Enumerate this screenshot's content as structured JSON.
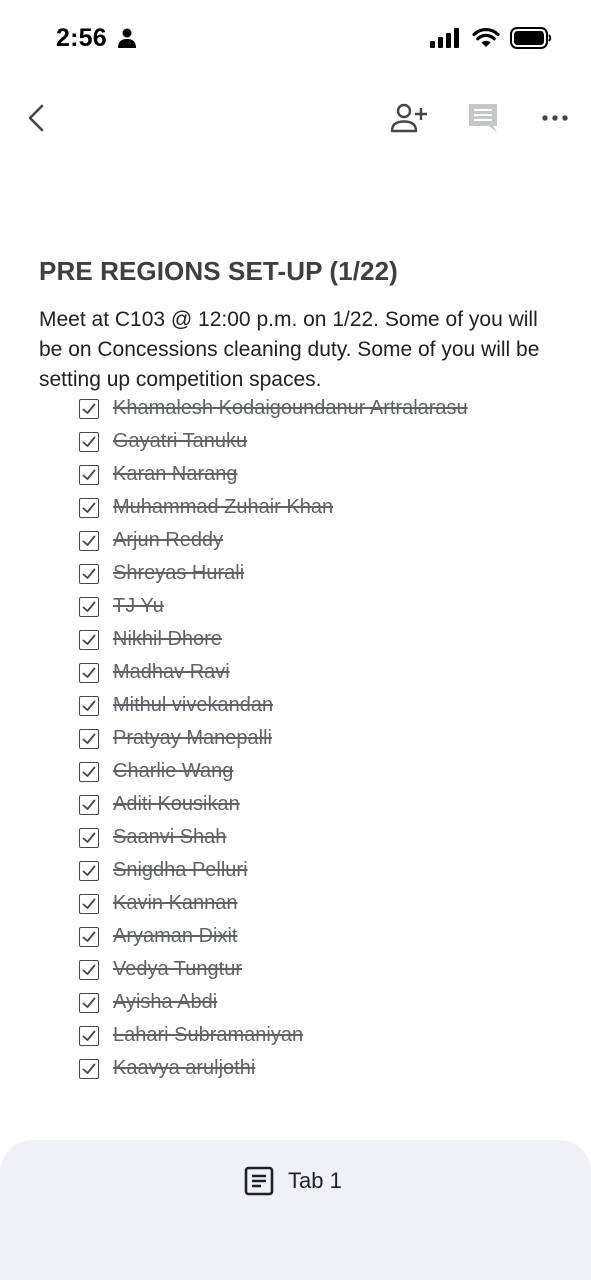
{
  "status_bar": {
    "time": "2:56"
  },
  "toolbar": {
    "back_icon": "chevron-left-icon",
    "share_icon": "person-add-icon",
    "comment_icon": "comment-icon",
    "more_icon": "more-horizontal-icon"
  },
  "document": {
    "title": "PRE REGIONS SET-UP (1/22)",
    "body": "Meet at C103 @ 12:00 p.m. on 1/22. Some of you will be on Concessions cleaning duty. Some of you will be setting up competition spaces."
  },
  "checklist": [
    {
      "label": "Khamalesh Kodaigoundanur Artralarasu",
      "checked": true
    },
    {
      "label": "Gayatri Tanuku",
      "checked": true
    },
    {
      "label": "Karan Narang",
      "checked": true
    },
    {
      "label": "Muhammad Zuhair Khan",
      "checked": true
    },
    {
      "label": "Arjun Reddy",
      "checked": true
    },
    {
      "label": "Shreyas Hurali",
      "checked": true
    },
    {
      "label": "TJ Yu",
      "checked": true
    },
    {
      "label": "Nikhil Dhore",
      "checked": true
    },
    {
      "label": "Madhav Ravi",
      "checked": true
    },
    {
      "label": "Mithul vivekandan",
      "checked": true
    },
    {
      "label": "Pratyay Manepalli",
      "checked": true
    },
    {
      "label": "Charlie Wang",
      "checked": true
    },
    {
      "label": "Aditi Kousikan",
      "checked": true
    },
    {
      "label": "Saanvi Shah",
      "checked": true
    },
    {
      "label": "Snigdha Pelluri",
      "checked": true
    },
    {
      "label": "Kavin Kannan",
      "checked": true
    },
    {
      "label": "Aryaman Dixit",
      "checked": true
    },
    {
      "label": "Vedya Tungtur",
      "checked": true
    },
    {
      "label": "Ayisha Abdi",
      "checked": true
    },
    {
      "label": "Lahari Subramaniyan",
      "checked": true
    },
    {
      "label": "Kaavya aruljothi",
      "checked": true
    }
  ],
  "bottom_tab": {
    "label": "Tab 1",
    "icon": "document-icon"
  },
  "colors": {
    "panel_bg": "#eef2f8",
    "title": "#3c4043",
    "struck_text": "#5f6368"
  }
}
